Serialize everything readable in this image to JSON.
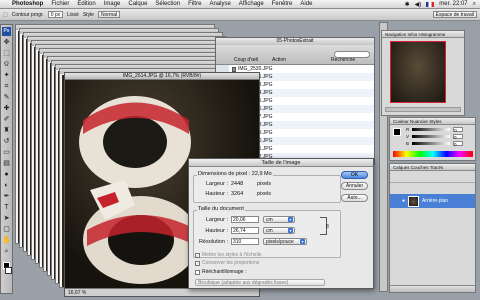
{
  "menubar": {
    "app": "Photoshop",
    "items": [
      "Fichier",
      "Édition",
      "Image",
      "Calque",
      "Sélection",
      "Filtre",
      "Analyse",
      "Affichage",
      "Fenêtre",
      "Aide"
    ],
    "clock": "mer. 22:07"
  },
  "options": {
    "contour": "Contour progr.",
    "contour_value": "0 px",
    "lisse": "Lissé",
    "style_label": "Style",
    "style_value": "Normal",
    "workspace": "Espace de travail"
  },
  "document": {
    "title": "IMG_2614.JPG @ 16,7% (RVB/8#)",
    "status": "16,67 %"
  },
  "browser": {
    "title": "05-PhotosExtrait",
    "coup_oeil": "Coup d'œil",
    "action": "Action",
    "recherche": "Recherche",
    "files": [
      "IMG_2530.JPG",
      "IMG_2531.JPG",
      "IMG_2533.JPG",
      "IMG_2534.JPG",
      "IMG_2535.JPG",
      "IMG_2536.JPG",
      "IMG_2537.JPG",
      "IMG_2538.JPG",
      "IMG_2539.JPG",
      "IMG_2540.JPG",
      "IMG_2541.JPG",
      "IMG_2542.JPG"
    ]
  },
  "panels": {
    "navigator_tabs": "Navigation  Infos  Histogramme",
    "colors_tabs": "Couleur  Nuancier  Styles",
    "colors_rows": [
      "R",
      "V",
      "B"
    ],
    "colors_values": [
      "0",
      "0",
      "0"
    ],
    "layers_tabs": "Calques  Couches  Tracés",
    "layer_name": "Arrière-plan"
  },
  "dialog": {
    "title": "Taille de l'image",
    "pixel_dim": "Dimensions de pixel : 22,9 Mo",
    "width_label": "Largeur :",
    "width_value": "2448",
    "width_unit": "pixels",
    "height_label": "Hauteur :",
    "height_value": "3264",
    "height_unit": "pixels",
    "doc_size": "Taille du document",
    "doc_width_label": "Largeur :",
    "doc_width_value": "20,06",
    "doc_width_unit": "cm",
    "doc_height_label": "Hauteur :",
    "doc_height_value": "26,74",
    "doc_height_unit": "cm",
    "res_label": "Résolution :",
    "res_value": "310",
    "res_unit": "pixels/pouce",
    "ok": "OK",
    "cancel": "Annuler",
    "auto": "Auto...",
    "scale_styles": "Mettre les styles à l'échelle",
    "constrain": "Conserver les proportions",
    "resample": "Rééchantillonnage :",
    "interpolation": "Bicubique (adaptée aux dégradés lisses)"
  }
}
